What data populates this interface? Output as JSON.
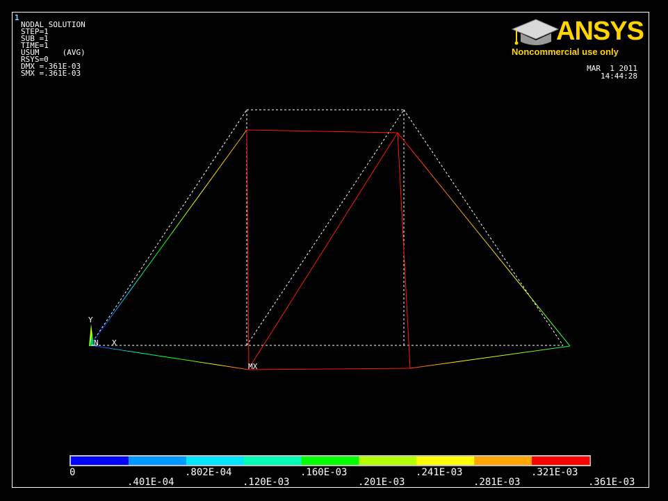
{
  "window_number": "1",
  "info_lines": [
    "NODAL SOLUTION",
    "STEP=1",
    "SUB =1",
    "TIME=1",
    "USUM     (AVG)",
    "RSYS=0",
    "DMX =.361E-03",
    "SMX =.361E-03"
  ],
  "logo": {
    "word": "ANSYS",
    "subtitle": "Noncommercial use only",
    "color": "#ffd400",
    "icon": "graduation-cap-icon"
  },
  "date": "MAR  1 2011",
  "time": "14:44:28",
  "triad": {
    "y_label": "Y",
    "x_label": "X",
    "node_label": "N"
  },
  "max_label": "MX",
  "legend": {
    "colors": [
      "#0000ff",
      "#0099ff",
      "#00e5ff",
      "#00ffb4",
      "#00ff00",
      "#b4ff00",
      "#ffff00",
      "#ffa500",
      "#ff0000"
    ],
    "labels": [
      "0",
      ".401E-04",
      ".802E-04",
      ".120E-03",
      ".160E-03",
      ".201E-03",
      ".241E-03",
      ".281E-03",
      ".321E-03",
      ".361E-03"
    ]
  }
}
